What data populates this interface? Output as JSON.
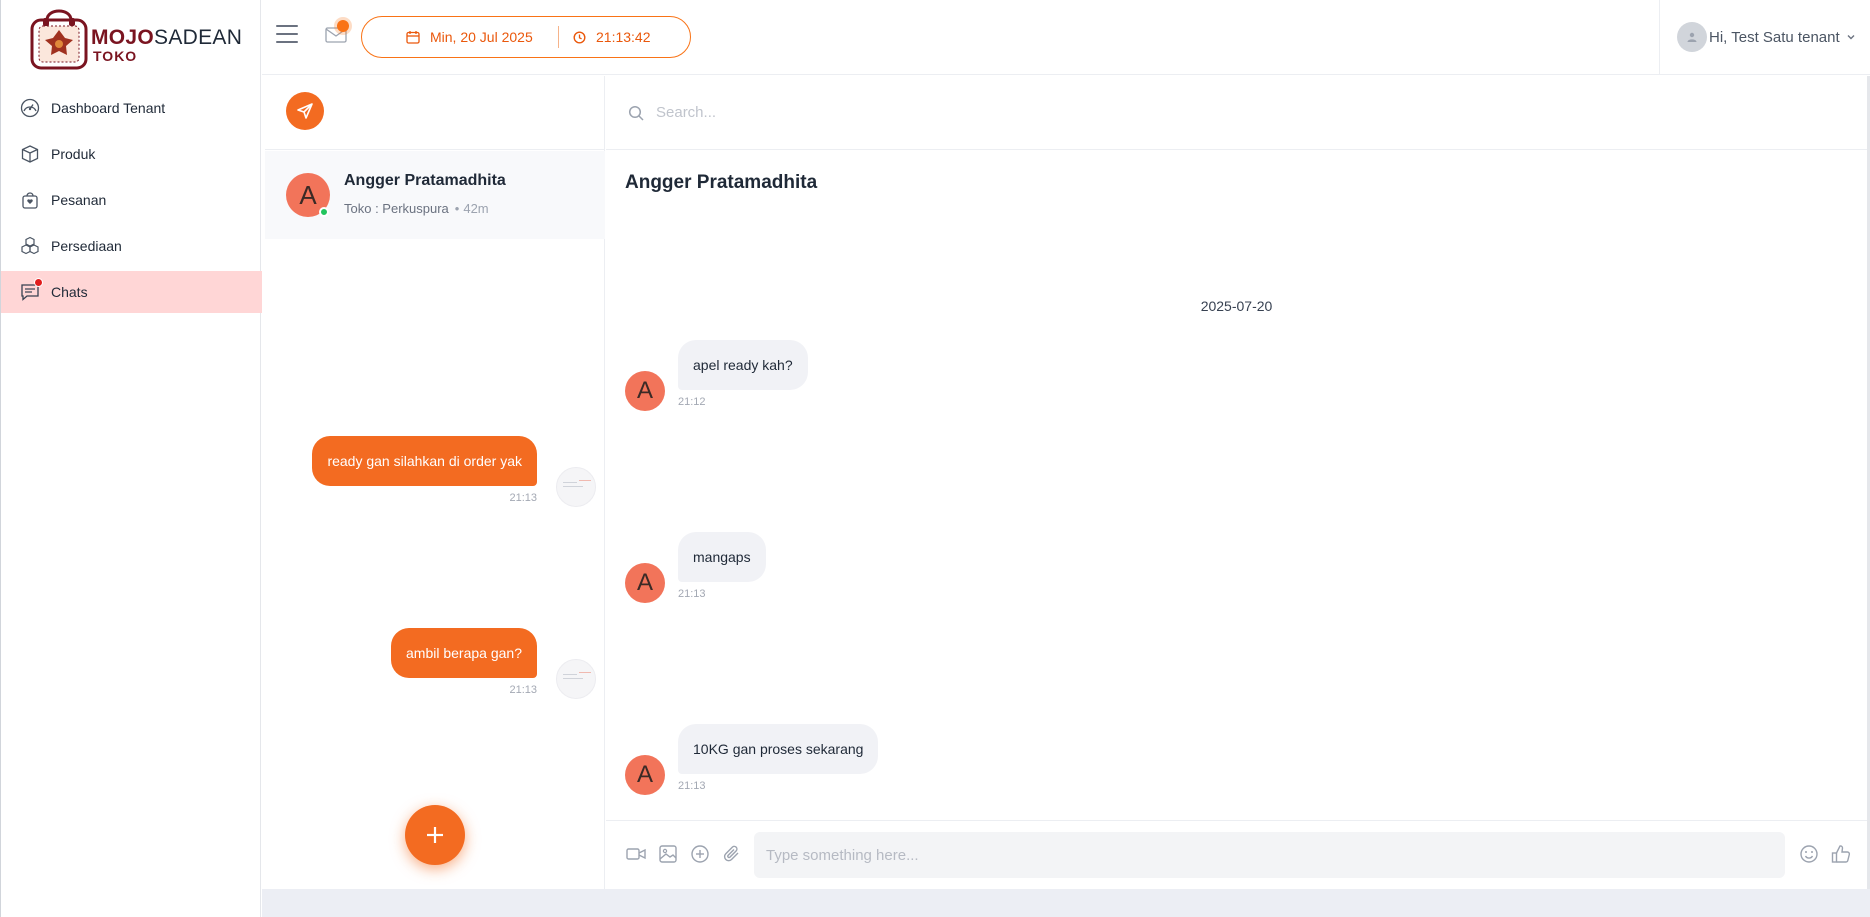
{
  "brand": {
    "name_part1": "MOJO",
    "name_part2": "SADEAN",
    "subtitle": "TOKO"
  },
  "sidebar": {
    "items": [
      {
        "label": "Dashboard Tenant",
        "icon": "dashboard-gauge-icon",
        "active": false
      },
      {
        "label": "Produk",
        "icon": "box-icon",
        "active": false
      },
      {
        "label": "Pesanan",
        "icon": "shopping-bag-icon",
        "active": false
      },
      {
        "label": "Persediaan",
        "icon": "stacked-boxes-icon",
        "active": false
      },
      {
        "label": "Chats",
        "icon": "chat-icon",
        "active": true,
        "has_notification": true
      }
    ]
  },
  "topbar": {
    "date": "Min, 20 Jul 2025",
    "time": "21:13:42",
    "user_greeting": "Hi, Test Satu tenant"
  },
  "chat_list": {
    "contacts": [
      {
        "initial": "A",
        "name": "Angger Pratamadhita",
        "store": "Toko : Perkuspura",
        "ago": "42m",
        "online": true
      }
    ]
  },
  "conversation": {
    "search_placeholder": "Search...",
    "title": "Angger Pratamadhita",
    "date_separator": "2025-07-20",
    "messages": [
      {
        "from": "other",
        "initial": "A",
        "text": "apel ready kah?",
        "time": "21:12"
      },
      {
        "from": "me",
        "text": "ready gan silahkan di order yak",
        "time": "21:13"
      },
      {
        "from": "other",
        "initial": "A",
        "text": "mangaps",
        "time": "21:13"
      },
      {
        "from": "me",
        "text": "ambil berapa gan?",
        "time": "21:13"
      },
      {
        "from": "other",
        "initial": "A",
        "text": "10KG gan proses sekarang",
        "time": "21:13"
      }
    ],
    "composer_placeholder": "Type something here..."
  },
  "colors": {
    "accent": "#f36b21",
    "brand": "#7a1420",
    "active_nav": "#ffd6d6",
    "avatar": "#f2745a"
  }
}
